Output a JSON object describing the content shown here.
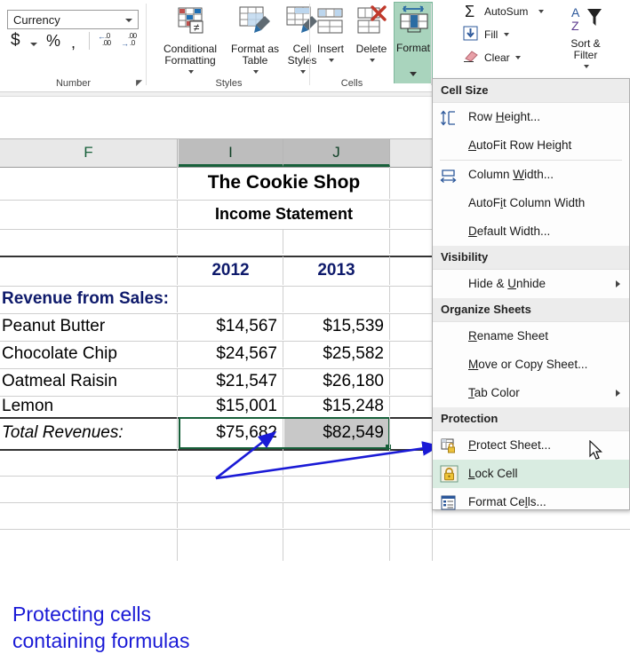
{
  "ribbon": {
    "number_group": {
      "label": "Number",
      "format_value": "Currency",
      "currency_icon": "$",
      "percent_icon": "%",
      "comma_icon": ",",
      "increase_decimal": ".00",
      "decrease_decimal": ".00",
      "launcher": "dialog-launcher"
    },
    "styles_group": {
      "label": "Styles",
      "buttons": [
        {
          "line1": "Conditional",
          "line2": "Formatting",
          "icon": "conditional-formatting-icon"
        },
        {
          "line1": "Format as",
          "line2": "Table",
          "icon": "format-as-table-icon"
        },
        {
          "line1": "Cell",
          "line2": "Styles",
          "icon": "cell-styles-icon"
        }
      ]
    },
    "cells_group": {
      "label": "Cells",
      "buttons": [
        {
          "label": "Insert",
          "icon": "insert-cells-icon"
        },
        {
          "label": "Delete",
          "icon": "delete-cells-icon"
        },
        {
          "label": "Format",
          "icon": "format-cells-ribbon-icon",
          "active": true
        }
      ]
    },
    "editing_group": {
      "autosum": "AutoSum",
      "fill": "Fill",
      "clear": "Clear",
      "sort_filter_line1": "Sort &",
      "sort_filter_line2": "Filter"
    }
  },
  "menu": {
    "sections": [
      {
        "header": "Cell Size",
        "items": [
          {
            "label": "Row Height...",
            "acc": "H",
            "icon": "row-height-icon",
            "submenu": false
          },
          {
            "label": "AutoFit Row Height",
            "acc": "A",
            "icon": "",
            "submenu": false
          },
          {
            "separator": true
          },
          {
            "label": "Column Width...",
            "acc": "W",
            "icon": "column-width-icon",
            "submenu": false
          },
          {
            "label": "AutoFit Column Width",
            "acc": "i",
            "icon": "",
            "submenu": false
          },
          {
            "label": "Default Width...",
            "acc": "D",
            "icon": "",
            "submenu": false
          }
        ]
      },
      {
        "header": "Visibility",
        "items": [
          {
            "label": "Hide & Unhide",
            "acc": "U",
            "icon": "",
            "submenu": true
          }
        ]
      },
      {
        "header": "Organize Sheets",
        "items": [
          {
            "label": "Rename Sheet",
            "acc": "R",
            "icon": "",
            "submenu": false
          },
          {
            "label": "Move or Copy Sheet...",
            "acc": "M",
            "icon": "",
            "submenu": false
          },
          {
            "label": "Tab Color",
            "acc": "T",
            "icon": "",
            "submenu": true
          }
        ]
      },
      {
        "header": "Protection",
        "items": [
          {
            "label": "Protect Sheet...",
            "acc": "P",
            "icon": "protect-sheet-icon",
            "submenu": false
          },
          {
            "label": "Lock Cell",
            "acc": "L",
            "icon": "lock-cell-icon",
            "submenu": false,
            "highlighted": true
          },
          {
            "label": "Format Cells...",
            "acc": "l",
            "icon": "format-cells-icon",
            "submenu": false
          }
        ]
      }
    ]
  },
  "sheet": {
    "column_headers": [
      {
        "label": "F",
        "selected": false
      },
      {
        "label": "I",
        "selected": true
      },
      {
        "label": "J",
        "selected": true
      },
      {
        "label": "",
        "selected": false
      }
    ],
    "title": "The Cookie Shop",
    "subtitle": "Income Statement",
    "year_headers": [
      "2012",
      "2013"
    ],
    "section_label": "Revenue from Sales:",
    "rows": [
      {
        "label": "Peanut Butter",
        "v2012": "$14,567",
        "v2013": "$15,539"
      },
      {
        "label": "Chocolate Chip",
        "v2012": "$24,567",
        "v2013": "$25,582"
      },
      {
        "label": "Oatmeal  Raisin",
        "v2012": "$21,547",
        "v2013": "$26,180"
      },
      {
        "label": "Lemon",
        "v2012": "$15,001",
        "v2013": "$15,248"
      }
    ],
    "total": {
      "label": "Total Revenues:",
      "v2012": "$75,682",
      "v2013": "$82,549"
    }
  },
  "annotation": {
    "line1": "Protecting cells",
    "line2": "containing formulas",
    "color": "#1a1ad6"
  },
  "colors": {
    "selection_green": "#17603a",
    "menu_highlight": "#d9ece1",
    "ribbon_active": "#a9d4bd",
    "navy_text": "#0e1a6b",
    "annotation_blue": "#1a1ad6"
  }
}
